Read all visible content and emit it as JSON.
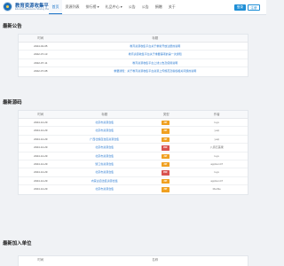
{
  "header": {
    "brand_name": "教育资源收集平台",
    "brand_sub": "Education Resource Sharing Platform",
    "nav": [
      "首页",
      "资源列表",
      "排行榜 ▾",
      "礼品中心 ▾",
      "公告",
      "公告",
      "捐赠",
      "关于"
    ],
    "login_label": "登录",
    "register_label": "注册"
  },
  "notices": {
    "title": "最新公告",
    "columns": [
      "时间",
      "标题"
    ],
    "rows": [
      {
        "date": "2024-02-05",
        "title": "教育资源收集平台关于重新开放注册的说明"
      },
      {
        "date": "2022-07-13",
        "title": "教育资源收集平台关于重要事项的第一次通知"
      },
      {
        "date": "2022-07-11",
        "title": "教育资源收集平台上线公告及使用说明"
      },
      {
        "date": "2022-07-08",
        "title": "重要通知：关于教育资源收集平台资源上传规范及版权相关问题的说明"
      }
    ]
  },
  "submissions": {
    "title": "最新源码",
    "columns": [
      "时间",
      "标题",
      "类型",
      "作者"
    ],
    "rows": [
      {
        "date": "2024-12-29",
        "title": "北京市资源合集",
        "type": "ZIP",
        "type_color": "#f0a020",
        "author": "luyu"
      },
      {
        "date": "2024-12-29",
        "title": "北京市资源合集",
        "type": "ZIP",
        "type_color": "#f0a020",
        "author": "yuqi"
      },
      {
        "date": "2024-12-29",
        "title": "广西壮族自治区资源合集",
        "type": "ZIP",
        "type_color": "#f0a020",
        "author": "yuqi"
      },
      {
        "date": "2024-12-29",
        "title": "北京市资源合集",
        "type": "PDF",
        "type_color": "#d9534f",
        "author": "八音石莲果"
      },
      {
        "date": "2024-12-29",
        "title": "北京市资源合集",
        "type": "ZIP",
        "type_color": "#f0a020",
        "author": "luyu"
      },
      {
        "date": "2024-12-29",
        "title": "浙江省资源合集",
        "type": "ZIP",
        "type_color": "#f0a020",
        "author": "applium47"
      },
      {
        "date": "2024-12-29",
        "title": "北京市资源合集",
        "type": "PDF",
        "type_color": "#d9534f",
        "author": "luyu"
      },
      {
        "date": "2024-12-29",
        "title": "内蒙古自治区资源合集",
        "type": "ZIP",
        "type_color": "#f0a020",
        "author": "applium47"
      },
      {
        "date": "2024-12-29",
        "title": "北京市资源合集",
        "type": "ZIP",
        "type_color": "#f0a020",
        "author": "Marble"
      }
    ]
  },
  "newest_users": {
    "title": "最新加入单位",
    "columns": [
      "时间",
      "名称"
    ]
  }
}
